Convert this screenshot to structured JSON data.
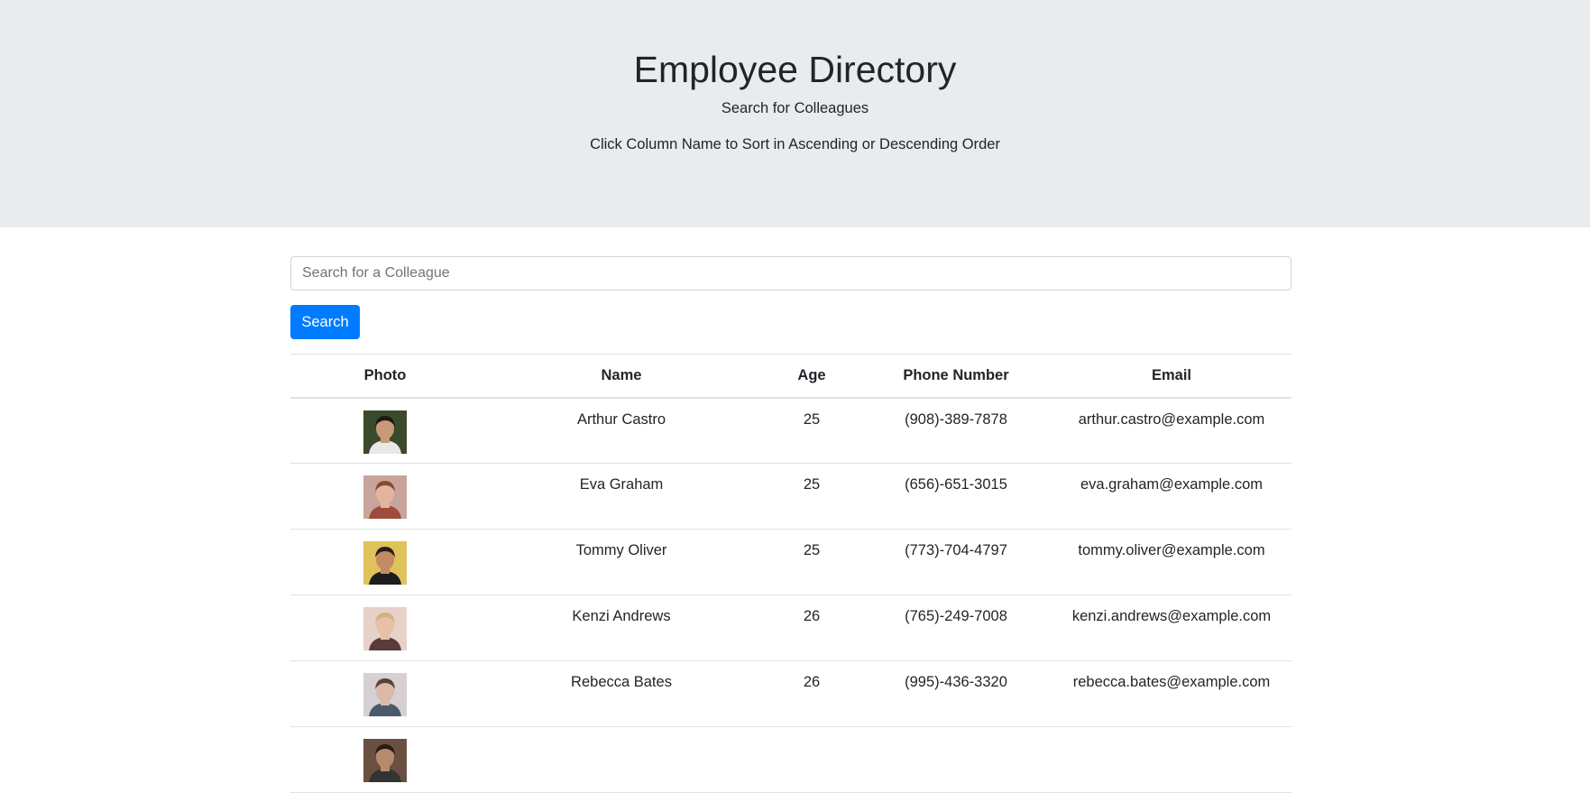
{
  "header": {
    "title": "Employee Directory",
    "subtitle": "Search for Colleagues",
    "hint": "Click Column Name to Sort in Ascending or Descending Order"
  },
  "search": {
    "placeholder": "Search for a Colleague",
    "value": "",
    "button_label": "Search"
  },
  "table": {
    "columns": [
      "Photo",
      "Name",
      "Age",
      "Phone Number",
      "Email"
    ],
    "rows": [
      {
        "name": "Arthur Castro",
        "age": "25",
        "phone": "(908)-389-7878",
        "email": "arthur.castro@example.com",
        "photo": {
          "bg": "#3a4a2c",
          "skin": "#c89a7a",
          "hair": "#1e1812",
          "shirt": "#e8e8e8"
        }
      },
      {
        "name": "Eva Graham",
        "age": "25",
        "phone": "(656)-651-3015",
        "email": "eva.graham@example.com",
        "photo": {
          "bg": "#c9a49a",
          "skin": "#e2b59c",
          "hair": "#8a4a32",
          "shirt": "#a04a3c"
        }
      },
      {
        "name": "Tommy Oliver",
        "age": "25",
        "phone": "(773)-704-4797",
        "email": "tommy.oliver@example.com",
        "photo": {
          "bg": "#e0c25a",
          "skin": "#c48a66",
          "hair": "#2a1e16",
          "shirt": "#1c1c1c"
        }
      },
      {
        "name": "Kenzi Andrews",
        "age": "26",
        "phone": "(765)-249-7008",
        "email": "kenzi.andrews@example.com",
        "photo": {
          "bg": "#e6d2c8",
          "skin": "#e8c0a8",
          "hair": "#d4b080",
          "shirt": "#5a3a3a"
        }
      },
      {
        "name": "Rebecca Bates",
        "age": "26",
        "phone": "(995)-436-3320",
        "email": "rebecca.bates@example.com",
        "photo": {
          "bg": "#d6cfd4",
          "skin": "#dcb8a6",
          "hair": "#5a4036",
          "shirt": "#4a5a6a"
        }
      },
      {
        "name": "",
        "age": "",
        "phone": "",
        "email": "",
        "photo": {
          "bg": "#6a5040",
          "skin": "#b88a6a",
          "hair": "#2a1a12",
          "shirt": "#333333"
        }
      }
    ]
  }
}
